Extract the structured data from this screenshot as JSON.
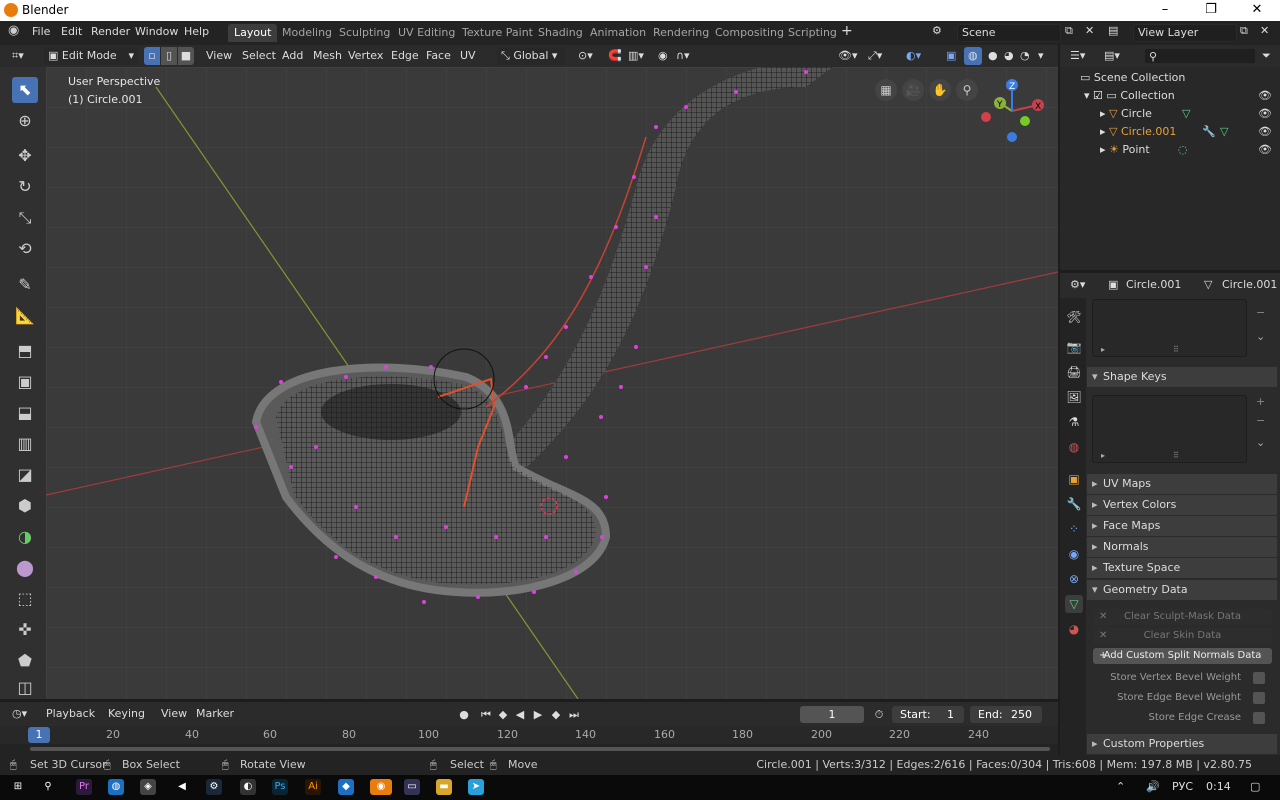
{
  "window": {
    "title": "Blender"
  },
  "menu": [
    "File",
    "Edit",
    "Render",
    "Window",
    "Help"
  ],
  "workspaces": [
    "Layout",
    "Modeling",
    "Sculpting",
    "UV Editing",
    "Texture Paint",
    "Shading",
    "Animation",
    "Rendering",
    "Compositing",
    "Scripting"
  ],
  "scene": {
    "name": "Scene",
    "view_layer": "View Layer"
  },
  "viewport_header": {
    "mode": "Edit Mode",
    "menus": [
      "View",
      "Select",
      "Add",
      "Mesh",
      "Vertex",
      "Edge",
      "Face",
      "UV"
    ],
    "transform_orientation": "Global"
  },
  "viewport": {
    "perspective_label": "User Perspective",
    "object_label": "(1) Circle.001",
    "gizmo": {
      "x": "X",
      "y": "Y",
      "z": "Z"
    }
  },
  "outliner": {
    "root": "Scene Collection",
    "collection": "Collection",
    "items": [
      {
        "name": "Circle",
        "active": false
      },
      {
        "name": "Circle.001",
        "active": true
      },
      {
        "name": "Point",
        "active": false
      }
    ]
  },
  "properties": {
    "object_name": "Circle.001",
    "data_name": "Circle.001",
    "panels": {
      "shape_keys": "Shape Keys",
      "uv_maps": "UV Maps",
      "vertex_colors": "Vertex Colors",
      "face_maps": "Face Maps",
      "normals": "Normals",
      "texture_space": "Texture Space",
      "geometry_data": "Geometry Data",
      "custom_properties": "Custom Properties"
    },
    "geometry_buttons": {
      "clear_sculpt": "Clear Sculpt-Mask Data",
      "clear_skin": "Clear Skin Data",
      "add_split_normals": "Add Custom Split Normals Data"
    },
    "geometry_checks": {
      "vertex_bevel": "Store Vertex Bevel Weight",
      "edge_bevel": "Store Edge Bevel Weight",
      "edge_crease": "Store Edge Crease"
    }
  },
  "timeline": {
    "menus": [
      "Playback",
      "Keying",
      "View",
      "Marker"
    ],
    "current_frame": "1",
    "start_label": "Start:",
    "start": "1",
    "end_label": "End:",
    "end": "250",
    "ruler": [
      "1",
      "20",
      "40",
      "60",
      "80",
      "100",
      "120",
      "140",
      "160",
      "180",
      "200",
      "220",
      "240"
    ]
  },
  "statusbar": {
    "hint1": "Set 3D Cursor",
    "hint2": "Box Select",
    "hint3": "Rotate View",
    "hint4": "Select",
    "hint5": "Move",
    "stats": "Circle.001 | Verts:3/312 | Edges:2/616 | Faces:0/304 | Tris:608 | Mem: 197.8 MB | v2.80.75"
  },
  "taskbar": {
    "lang": "РУС",
    "time": "0:14"
  },
  "colors": {
    "accent": "#4772b3",
    "active_item": "#e8a13a",
    "vertex": "#e040e0",
    "x_axis": "#c8404a",
    "y_axis": "#8ab23a",
    "z_axis": "#3b7ce0"
  }
}
